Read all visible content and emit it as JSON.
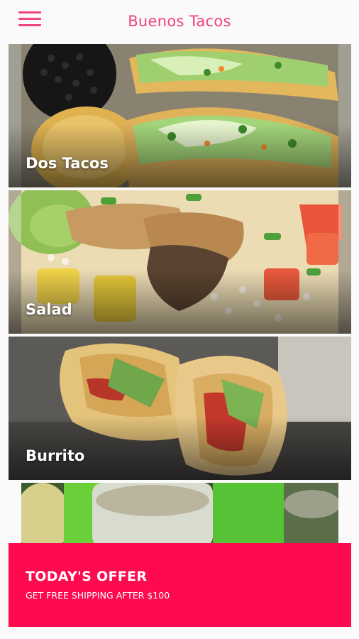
{
  "header": {
    "title": "Buenos Tacos",
    "menu_icon": "hamburger-menu-icon",
    "accent_color": "#f0427a"
  },
  "menu": {
    "items": [
      {
        "label": "Dos Tacos"
      },
      {
        "label": "Salad"
      },
      {
        "label": "Burrito"
      }
    ]
  },
  "offer": {
    "title": "TODAY'S OFFER",
    "subtitle": "GET FREE SHIPPING AFTER $100",
    "background_color": "#fe0a4e"
  }
}
